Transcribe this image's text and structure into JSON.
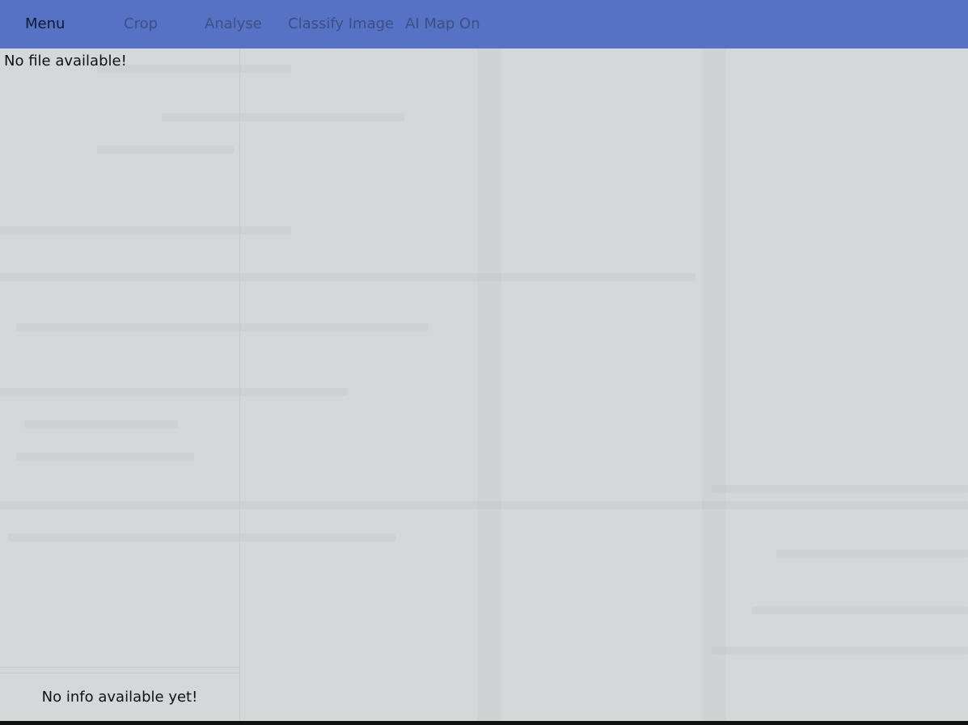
{
  "toolbar": {
    "menu_label": "Menu",
    "crop_label": "Crop",
    "analyse_label": "Analyse",
    "classify_label": "Classify Image",
    "ai_map_label": "AI Map On"
  },
  "sidebar": {
    "file_status": "No file available!",
    "info_status": "No info available yet!"
  },
  "colors": {
    "toolbar_bg": "#5672c4",
    "toolbar_text_inactive": "#3e4f80",
    "toolbar_text_active": "#111a2e",
    "content_bg": "#d4d8d9"
  }
}
